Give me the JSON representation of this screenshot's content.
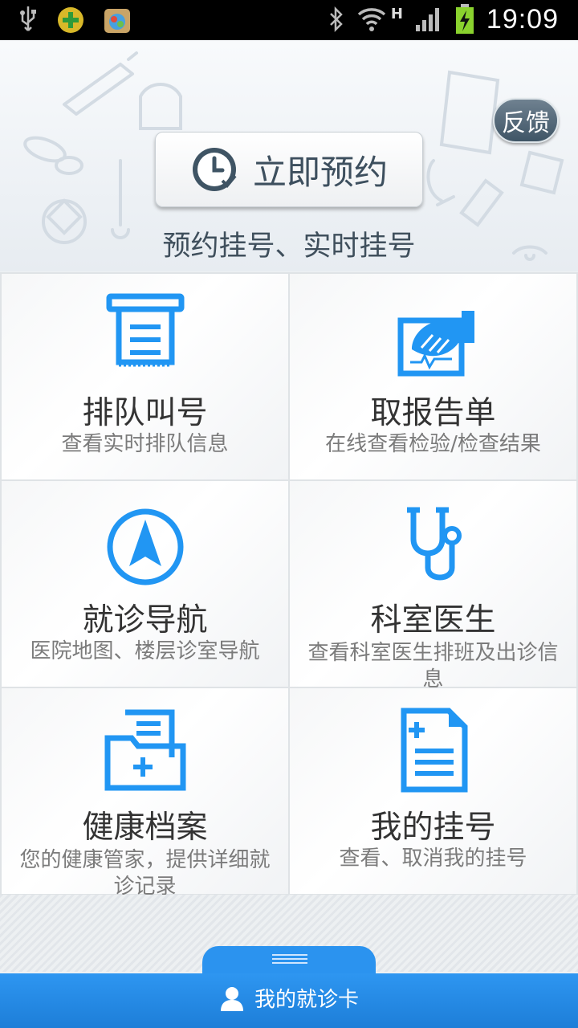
{
  "statusbar": {
    "time": "19:09",
    "network": "H"
  },
  "header": {
    "feedback_label": "反馈",
    "book_label": "立即预约",
    "book_subtitle": "预约挂号、实时挂号"
  },
  "grid": {
    "items": [
      {
        "title": "排队叫号",
        "desc": "查看实时排队信息"
      },
      {
        "title": "取报告单",
        "desc": "在线查看检验/检查结果"
      },
      {
        "title": "就诊导航",
        "desc": "医院地图、楼层诊室导航"
      },
      {
        "title": "科室医生",
        "desc": "查看科室医生排班及出诊信息"
      },
      {
        "title": "健康档案",
        "desc": "您的健康管家，提供详细就诊记录"
      },
      {
        "title": "我的挂号",
        "desc": "查看、取消我的挂号"
      }
    ]
  },
  "bottom": {
    "card_label": "我的就诊卡"
  },
  "colors": {
    "accent": "#2196F3",
    "button_text": "#3d4f5e"
  }
}
